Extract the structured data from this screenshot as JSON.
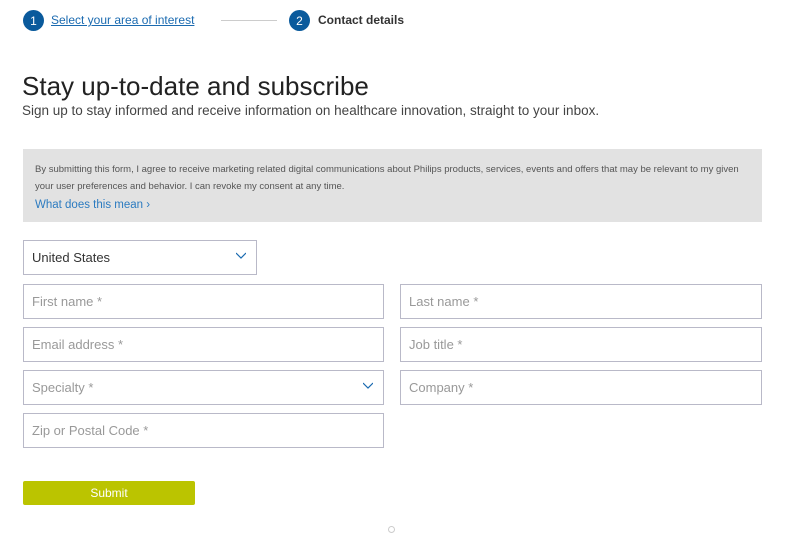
{
  "stepper": {
    "steps": [
      {
        "number": "1",
        "label": "Select your area of interest"
      },
      {
        "number": "2",
        "label": "Contact details"
      }
    ]
  },
  "header": {
    "title": "Stay up-to-date and subscribe",
    "subtitle": "Sign up to stay informed and receive information on healthcare innovation, straight to your inbox."
  },
  "consent": {
    "text": "By submitting this form, I agree to receive marketing related digital communications about Philips products, services, events and offers that may be relevant to my given your user preferences and behavior. I can revoke my consent at any time.",
    "link": "What does this mean ›"
  },
  "form": {
    "country": "United States",
    "first_name": "First name  *",
    "last_name": "Last name  *",
    "email": "Email address  *",
    "job_title": "Job title *",
    "specialty": "Specialty *",
    "company": "Company *",
    "zip": "Zip or Postal Code *",
    "submit": "Submit"
  },
  "colors": {
    "accent": "#bbc400",
    "step": "#0a5a9c",
    "link": "#2c7bc0"
  }
}
